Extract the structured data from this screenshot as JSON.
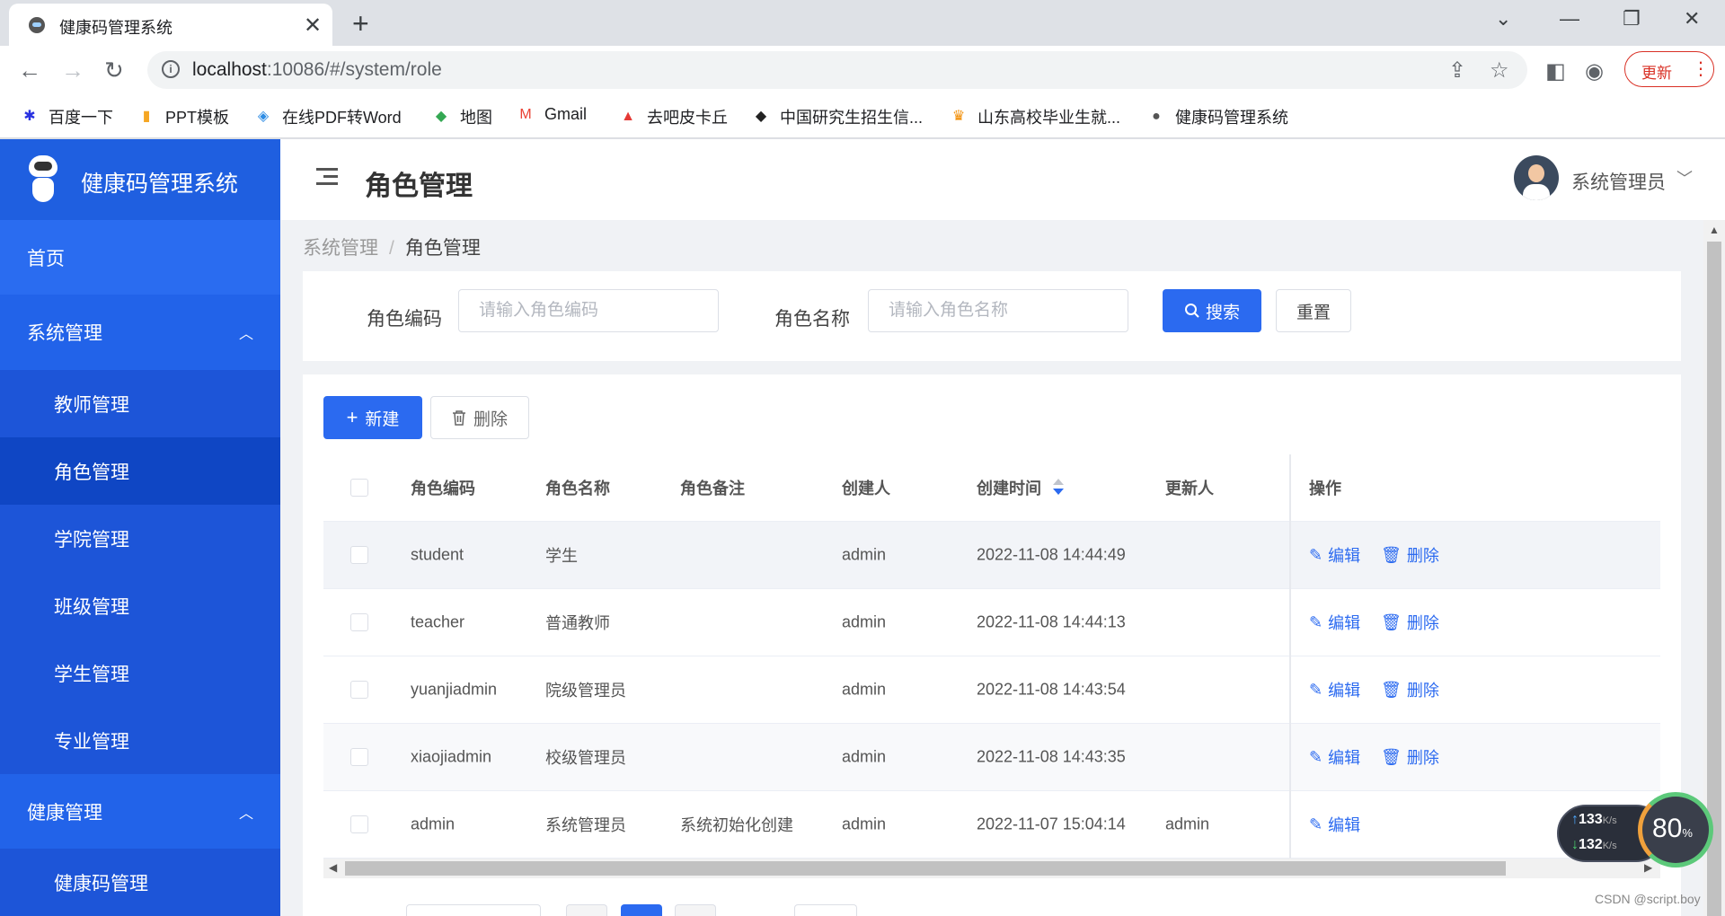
{
  "browser": {
    "tab_title": "健康码管理系统",
    "url_host": "localhost",
    "url_rest": ":10086/#/system/role",
    "update_label": "更新",
    "bookmarks": [
      {
        "label": "百度一下",
        "icon": "paw-icon",
        "color": "#2932e1"
      },
      {
        "label": "PPT模板",
        "icon": "ppt-icon",
        "color": "#f5a623"
      },
      {
        "label": "在线PDF转Word",
        "icon": "pdf-icon",
        "color": "#2f8de4"
      },
      {
        "label": "地图",
        "icon": "map-icon",
        "color": "#34a853"
      },
      {
        "label": "Gmail",
        "icon": "gmail-icon",
        "color": "#ea4335"
      },
      {
        "label": "去吧皮卡丘",
        "icon": "watermelon-icon",
        "color": "#e53935"
      },
      {
        "label": "中国研究生招生信...",
        "icon": "graduation-cap-icon",
        "color": "#222222"
      },
      {
        "label": "山东高校毕业生就...",
        "icon": "emblem-icon",
        "color": "#f28c00"
      },
      {
        "label": "健康码管理系统",
        "icon": "robot-icon",
        "color": "#555555"
      }
    ]
  },
  "app": {
    "brand": "健康码管理系统",
    "page_title": "角色管理",
    "user_name": "系统管理员",
    "accent": "#2b6af0",
    "sidebar_color": "#2263e9"
  },
  "sidebar": {
    "home": "首页",
    "group_system": "系统管理",
    "system_items": [
      "教师管理",
      "角色管理",
      "学院管理",
      "班级管理",
      "学生管理",
      "专业管理"
    ],
    "active_item": "角色管理",
    "group_health": "健康管理",
    "health_items": [
      "健康码管理"
    ]
  },
  "breadcrumb": {
    "parent": "系统管理",
    "sep": "/",
    "current": "角色管理"
  },
  "search": {
    "code_label": "角色编码",
    "code_placeholder": "请输入角色编码",
    "name_label": "角色名称",
    "name_placeholder": "请输入角色名称",
    "search_label": "搜索",
    "reset_label": "重置"
  },
  "actions": {
    "new_label": "新建",
    "delete_label": "删除"
  },
  "table": {
    "columns": [
      "角色编码",
      "角色名称",
      "角色备注",
      "创建人",
      "创建时间",
      "更新人",
      "操作"
    ],
    "edit_label": "编辑",
    "delete_label": "删除",
    "rows": [
      {
        "code": "student",
        "name": "学生",
        "remark": "",
        "creator": "admin",
        "created": "2022-11-08 14:44:49",
        "updater": ""
      },
      {
        "code": "teacher",
        "name": "普通教师",
        "remark": "",
        "creator": "admin",
        "created": "2022-11-08 14:44:13",
        "updater": ""
      },
      {
        "code": "yuanjiadmin",
        "name": "院级管理员",
        "remark": "",
        "creator": "admin",
        "created": "2022-11-08 14:43:54",
        "updater": ""
      },
      {
        "code": "xiaojiadmin",
        "name": "校级管理员",
        "remark": "",
        "creator": "admin",
        "created": "2022-11-08 14:43:35",
        "updater": ""
      },
      {
        "code": "admin",
        "name": "系统管理员",
        "remark": "系统初始化创建",
        "creator": "admin",
        "created": "2022-11-07 15:04:14",
        "updater": "admin"
      }
    ]
  },
  "overlay": {
    "up_speed": "133",
    "down_speed": "132",
    "speed_unit": "K/s",
    "percent": "80",
    "percent_unit": "%",
    "watermark": "CSDN @script.boy"
  }
}
